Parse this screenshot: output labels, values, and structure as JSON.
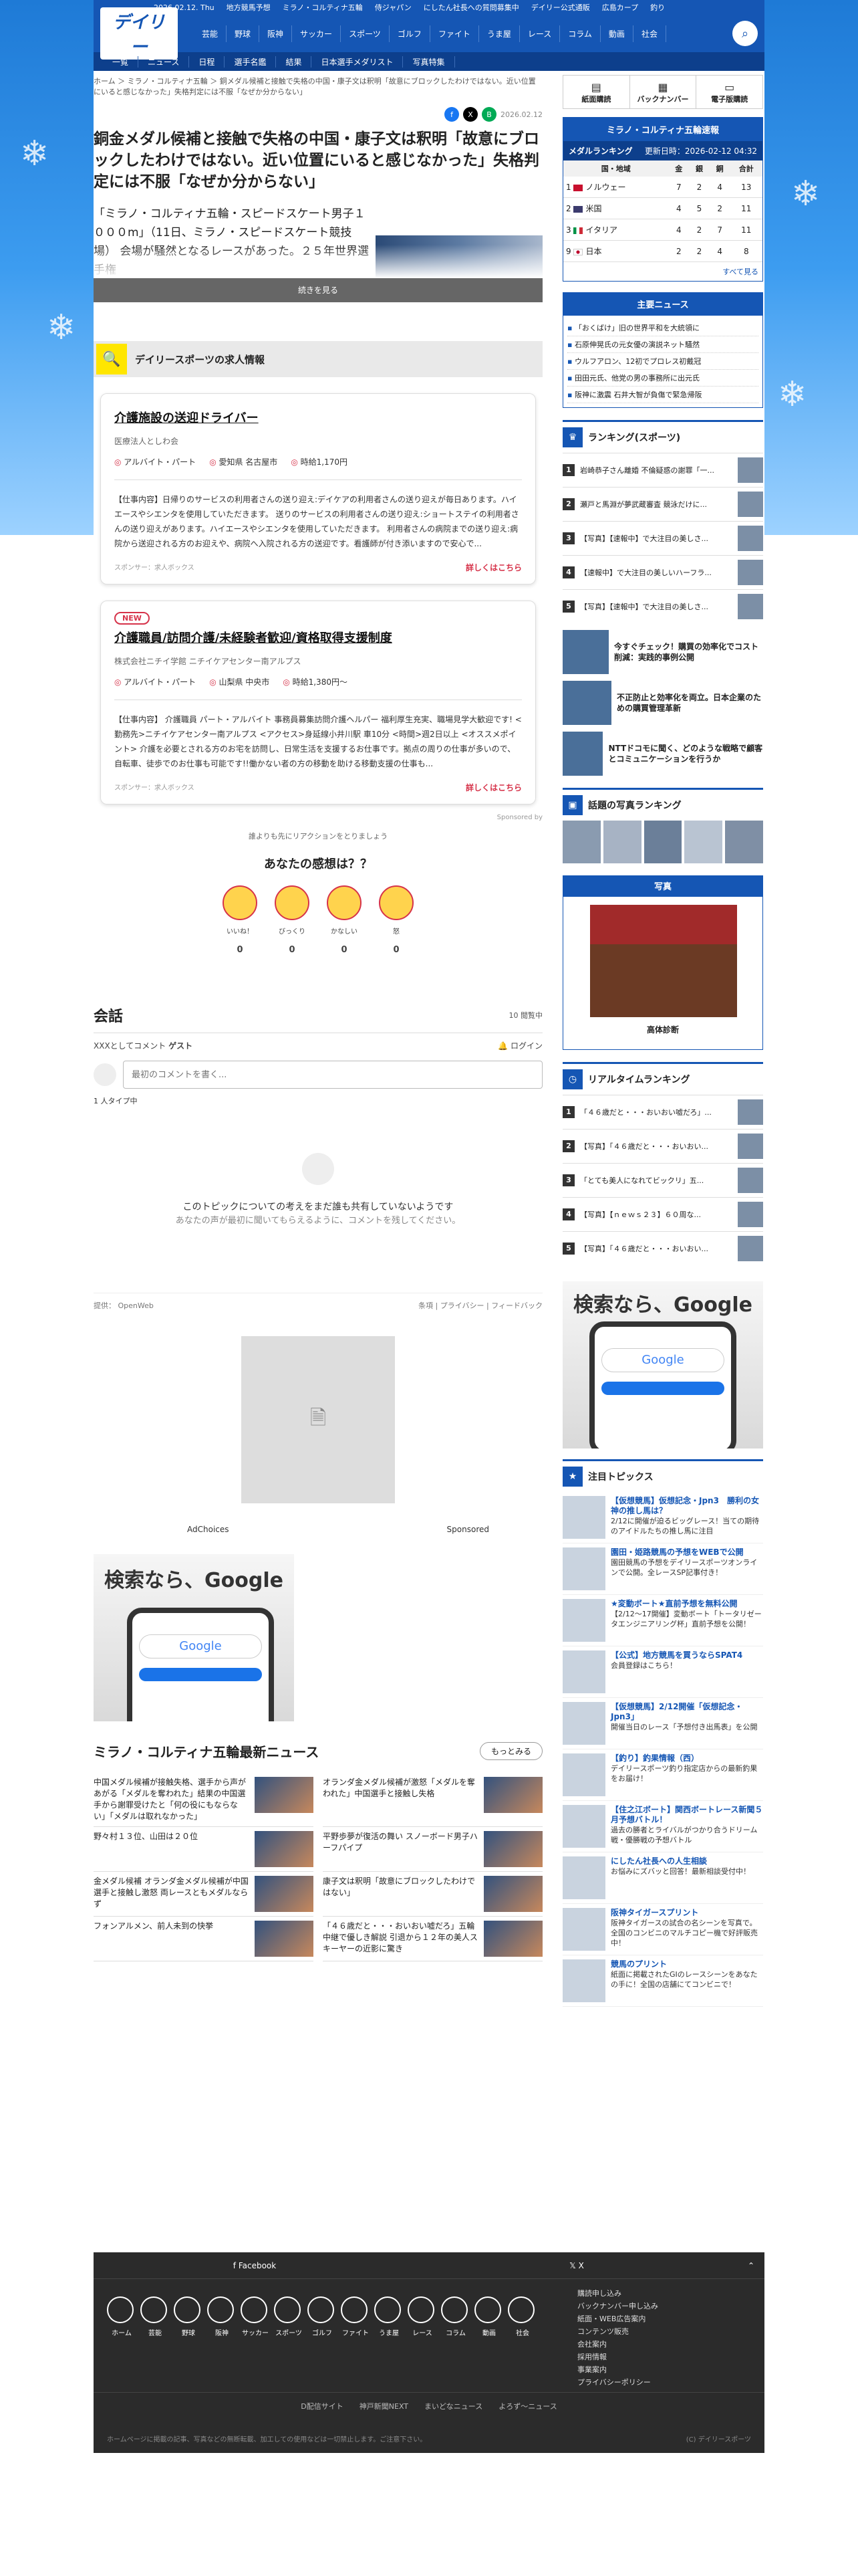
{
  "top_links": [
    "2026.02.12. Thu",
    "地方競馬予想",
    "ミラノ・コルティナ五輪",
    "侍ジャパン",
    "にしたん社長への質問募集中",
    "デイリー公式通販",
    "広島カープ",
    "釣り"
  ],
  "logo": "デイリー",
  "cat_nav": [
    "芸能",
    "野球",
    "阪神",
    "サッカー",
    "スポーツ",
    "ゴルフ",
    "ファイト",
    "うま屋",
    "レース",
    "コラム",
    "動画",
    "社会"
  ],
  "sub_nav": [
    "一覧",
    "ニュース",
    "日程",
    "選手名鑑",
    "結果",
    "日本選手メダリスト",
    "写真特集"
  ],
  "breadcrumb": "ホーム ＞ ミラノ・コルティナ五輪 ＞ 銅メダル候補と接触で失格の中国・康子文は釈明「故意にブロックしたわけではない。近い位置にいると感じなかった」失格判定には不服「なぜか分からない」",
  "article": {
    "date": "2026.02.12",
    "headline": "銅金メダル候補と接触で失格の中国・康子文は釈明「故意にブロックしたわけではない。近い位置にいると感じなかった」失格判定には不服「なぜか分からない」",
    "lead": "「ミラノ・コルティナ五輪・スピードスケート男子１０００m」（11日、ミラノ・スピードスケート競技場） 会場が騒然となるレースがあった。２５年世界選手権",
    "read_more": "続きを見る"
  },
  "jobs": {
    "header": "デイリースポーツの求人情報",
    "items": [
      {
        "new": "",
        "title": "介護施設の送迎ドライバー",
        "company": "医療法人としわ会",
        "tags": [
          "アルバイト・パート",
          "愛知県 名古屋市",
          "時給1,170円"
        ],
        "desc": "【仕事内容】日帰りのサービスの利用者さんの送り迎え:デイケアの利用者さんの送り迎えが毎日あります。ハイエースやシエンタを使用していただきます。 送りのサービスの利用者さんの送り迎え:ショートステイの利用者さんの送り迎えがあります。ハイエースやシエンタを使用していただきます。 利用者さんの病院までの送り迎え:病院から送迎される方のお迎えや、病院へ入院される方の送迎です。看護師が付き添いますので安心で...",
        "sponsor": "スポンサー：求人ボックス",
        "more": "詳しくはこちら"
      },
      {
        "new": "NEW",
        "title": "介護職員/訪問介護/未経験者歓迎/資格取得支援制度",
        "company": "株式会社ニチイ学館 ニチイケアセンター南アルプス",
        "tags": [
          "アルバイト・パート",
          "山梨県 中央市",
          "時給1,380円〜"
        ],
        "desc": "【仕事内容】 介護職員 パート・アルバイト 事務員募集訪問介護ヘルパー 福利厚生充実、職場見学大歓迎です! <勤務先>ニチイケアセンター南アルプス <アクセス>身延線小井川駅 車10分 <時間>週2日以上 <オススメポイント> 介護を必要とされる方のお宅を訪問し、日常生活を支援するお仕事です。拠点の周りの仕事が多いので、自転車、徒歩でのお仕事も可能です!!働かない者の方の移動を助ける移動支援の仕事も...",
        "sponsor": "スポンサー：求人ボックス",
        "more": "詳しくはこちら"
      }
    ],
    "sponsored_by": "Sponsored by"
  },
  "reactions": {
    "prompt": "誰よりも先にリアクションをとりましょう",
    "title": "あなたの感想は？？",
    "items": [
      {
        "label": "いいね！",
        "count": "0"
      },
      {
        "label": "びっくり",
        "count": "0"
      },
      {
        "label": "かなしい",
        "count": "0"
      },
      {
        "label": "怒",
        "count": "0"
      }
    ]
  },
  "conversation": {
    "title": "会話",
    "viewers": "10 閲覧中",
    "as_text": "XXXとしてコメント",
    "guest": "ゲスト",
    "login": "ログイン",
    "placeholder": "最初のコメントを書く...",
    "typing": "1 人タイプ中",
    "empty_title": "このトピックについての考えをまだ誰も共有していないようです",
    "empty_sub": "あなたの声が最初に聞いてもらえるように、コメントを残してください。",
    "powered": "提供： OpenWeb",
    "links": "条項 | プライバシー | フィードバック"
  },
  "ads": {
    "adchoices": "AdChoices",
    "sponsored": "Sponsored",
    "google": "検索なら、Google",
    "google_btn": "Google"
  },
  "latest": {
    "title": "ミラノ・コルティナ五輪最新ニュース",
    "more": "もっとみる",
    "items": [
      "中国メダル候補が接触失格、選手から声があがる「メダルを奪われた」結果の中国選手から謝罪受けたと「何の役にもならない」「メダルは取れなかった」",
      "オランダ金メダル候補が激怒「メダルを奪われた」中国選手と接触し失格",
      "野々村１３位、山田は２０位",
      "平野歩夢が復活の舞い スノーボード男子ハーフパイプ",
      "金メダル候補 オランダ金メダル候補が中国選手と接触し激怒 両レースともメダルならず",
      "康子文は釈明「故意にブロックしたわけではない」",
      "フォンアルメン、前人未到の快挙",
      "「４６歳だと・・・おいおい嘘だろ」五輪中継で優しき解説 引退から１２年の美人スキーヤーの近影に驚き"
    ]
  },
  "side": {
    "buttons": [
      "紙面購読",
      "バックナンバー",
      "電子版購読"
    ],
    "medal_title": "ミラノ・コルティナ五輪速報",
    "medal_sub": "メダルランキング",
    "medal_updated": "更新日時：2026-02-12 04:32",
    "medal_cols": [
      "国・地域",
      "金",
      "銀",
      "銅",
      "合計"
    ],
    "medals": [
      {
        "rank": "1",
        "name": "ノルウェー",
        "g": "7",
        "s": "2",
        "b": "4",
        "t": "13"
      },
      {
        "rank": "2",
        "name": "米国",
        "g": "4",
        "s": "5",
        "b": "2",
        "t": "11"
      },
      {
        "rank": "3",
        "name": "イタリア",
        "g": "4",
        "s": "2",
        "b": "7",
        "t": "11"
      },
      {
        "rank": "9",
        "name": "日本",
        "g": "2",
        "s": "2",
        "b": "4",
        "t": "8"
      }
    ],
    "medal_more": "すべて見る",
    "main_news_title": "主要ニュース",
    "main_news": [
      "「おくばけ」旧の世界平和を大統領に",
      "石原伸晃氏の元女優の演説ネット騒然",
      "ウルフアロン、12初でプロレス初戴冠",
      "田田元氏、他党の男の事務所に出元氏",
      "阪神に激震 石井大智が負傷で緊急帰阪"
    ],
    "ranking_title": "ランキング(スポーツ)",
    "ranking": [
      "岩崎恭子さん離婚 不倫疑惑の謝罪「一...",
      "瀬戸と馬淵が夢武蔵審査 競泳だけに...",
      "【写真】【速報中】で大注目の美しさ...",
      "【速報中】で大注目の美しいハーフラ...",
      "【写真】【速報中】で大注目の美しさ..."
    ],
    "promos": [
      "今すぐチェック！購買の効率化でコスト削減：実践的事例公開",
      "不正防止と効率化を両立。日本企業のための購買管理革新",
      "NTTドコモに聞く、どのような戦略で顧客とコミュニケーションを行うか"
    ],
    "photo_rank_title": "話題の写真ランキング",
    "photo_title": "写真",
    "photo_caption": "高体診断",
    "realtime_title": "リアルタイムランキング",
    "realtime": [
      "「４６歳だと・・・おいおい嘘だろ」...",
      "【写真】「４６歳だと・・・おいおい...",
      "「とても美人になれてビックリ」五...",
      "【写真】【ｎｅｗｓ２３】６０周な...",
      "【写真】「４６歳だと・・・おいおい..."
    ],
    "topics_title": "注目トピックス",
    "topics": [
      {
        "t": "【仮想競馬】仮想記念・Jpn3　勝利の女神の推し馬は？",
        "d": "2/12に開催が迫るビッグレース！当ての期待のアイドルたちの推し馬に注目"
      },
      {
        "t": "園田・姫路競馬の予想をWEBで公開",
        "d": "園田競馬の予想をデイリースポーツオンラインで公開。全レースSP記事付き！"
      },
      {
        "t": "★変動ボート★直前予想を無料公開",
        "d": "【2/12〜17開催】変動ボート「トータリゼータエンジニアリング杯」直前予想を公開！"
      },
      {
        "t": "【公式】地方競馬を買うならSPAT4",
        "d": "会員登録はこちら！"
      },
      {
        "t": "【仮想競馬】2/12開催「仮想記念・Jpn3」",
        "d": "開催当日のレース「予想付き出馬表」を公開"
      },
      {
        "t": "【釣り】釣果情報（西）",
        "d": "デイリースポーツ釣り指定店からの最新釣果をお届け！"
      },
      {
        "t": "【住之江ボート】関西ボートレース新聞５月予想バトル！",
        "d": "過去の勝者とライバルがつかり合うドリーム戦・優勝戦の予想バトル"
      },
      {
        "t": "にしたん社長への人生相談",
        "d": "お悩みにズバッと回答！最新相談受付中！"
      },
      {
        "t": "阪神タイガースプリント",
        "d": "阪神タイガースの試合の名シーンを写真で。全国のコンビニのマルチコピー機で好評販売中！"
      },
      {
        "t": "競馬のプリント",
        "d": "紙面に掲載されたGIのレースシーンをあなたの手に！全国の店舗にてコンビニで！"
      }
    ]
  },
  "footer": {
    "social": [
      "Facebook",
      "X"
    ],
    "icons": [
      "ホーム",
      "芸能",
      "野球",
      "阪神",
      "サッカー",
      "スポーツ",
      "ゴルフ",
      "ファイト",
      "うま屋",
      "レース",
      "コラム",
      "動画",
      "社会"
    ],
    "links": [
      "購読申し込み",
      "バックナンバー申し込み",
      "紙面・WEB広告案内",
      "コンテンツ販売",
      "会社案内",
      "採用情報",
      "事業案内",
      "プライバシーポリシー"
    ],
    "sister": [
      "D配信サイト",
      "神戸新聞NEXT",
      "まいどなニュース",
      "よろず～ニュース"
    ],
    "copy": "ホームページに掲載の記事、写真などの無断転載、加工しての使用などは一切禁止します。ご注意下さい。",
    "copyright": "(C) デイリースポーツ"
  }
}
